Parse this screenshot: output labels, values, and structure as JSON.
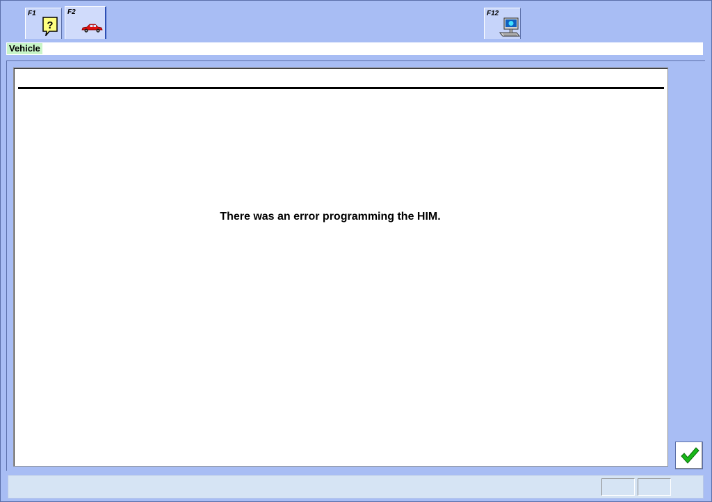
{
  "toolbar": {
    "tabs": [
      {
        "key": "F1",
        "icon": "help-icon"
      },
      {
        "key": "F2",
        "icon": "vehicle-car-icon"
      },
      {
        "key": "F12",
        "icon": "computer-tools-icon"
      }
    ]
  },
  "header": {
    "breadcrumb": "Vehicle"
  },
  "main": {
    "message": "There was an error programming the HIM."
  },
  "actions": {
    "ok_icon": "checkmark-icon"
  },
  "status_bar": {
    "text": "",
    "cell_1": "",
    "cell_2": ""
  },
  "colors": {
    "background": "#a8bdf4",
    "tab_active_border": "#2d4fb5",
    "breadcrumb_highlight": "#c8f5c8",
    "status_bar": "#d6e4f4",
    "check_green": "#18b818"
  }
}
